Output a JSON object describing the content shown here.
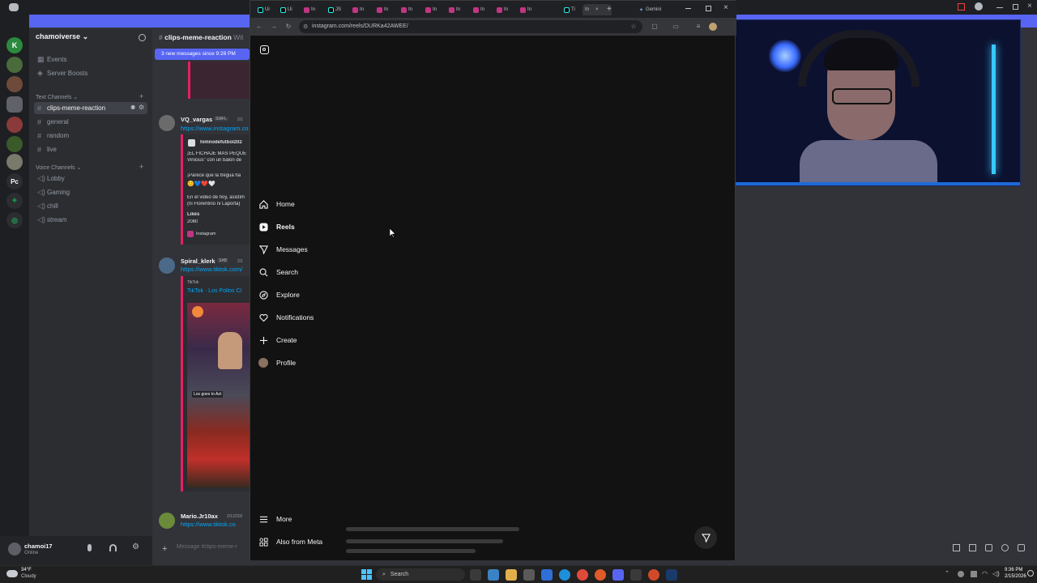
{
  "discord": {
    "server_name": "chamoiverse",
    "banner_text": "3 new messages since 9:28 PM",
    "channel_header": "clips-meme-reaction",
    "channel_header_extra": "Wit",
    "nav": [
      {
        "label": "Events",
        "icon": "calendar-icon"
      },
      {
        "label": "Server Boosts",
        "icon": "boost-icon"
      }
    ],
    "text_category": "Text Channels",
    "text_channels": [
      "clips-meme-reaction",
      "general",
      "random",
      "live"
    ],
    "voice_category": "Voice Channels",
    "voice_channels": [
      "Lobby",
      "Gaming",
      "chill",
      "stream"
    ],
    "server_rail_labels": [
      "Pc"
    ],
    "user": {
      "name": "chamoi17",
      "status": "Online"
    },
    "input_placeholder": "Message #clips-meme-r",
    "messages": [
      {
        "author": "VQ_vargas",
        "tag": "SWFL",
        "time": "2/1",
        "link": "https://www.instagram.co",
        "embed_author": "himnodefutbol202",
        "embed_lines": [
          "¡EL FICHAJE MÁS PEQUE",
          "Vinicius\" con un balón de",
          "¡Parece que la tregua ha",
          "En el video de hoy, asistim",
          "(ni Florentino ni Laporta)"
        ],
        "embed_likes_label": "Likes",
        "embed_likes": "2080",
        "embed_footer": "Instagram"
      },
      {
        "author": "Spiral_klerk",
        "tag": "SAB",
        "time": "2/1",
        "link": "https://www.tiktok.com/",
        "embed_provider": "TikTok",
        "embed_title": "TikTok · Los Pollos Cl",
        "video_caption": "Los goes to Azt"
      },
      {
        "author": "Mario.Jr10ax",
        "time": "2/12/202",
        "link": "https://www.tiktok.co"
      }
    ]
  },
  "browser": {
    "tabs": [
      {
        "label": "Ui",
        "kind": "tiktok"
      },
      {
        "label": "Ui",
        "kind": "tiktok"
      },
      {
        "label": "In",
        "kind": "instagram"
      },
      {
        "label": "JS",
        "kind": "tiktok"
      },
      {
        "label": "In",
        "kind": "instagram"
      },
      {
        "label": "In",
        "kind": "instagram"
      },
      {
        "label": "In",
        "kind": "instagram"
      },
      {
        "label": "In",
        "kind": "instagram"
      },
      {
        "label": "In",
        "kind": "instagram"
      },
      {
        "label": "In",
        "kind": "instagram"
      },
      {
        "label": "In",
        "kind": "instagram"
      },
      {
        "label": "In",
        "kind": "instagram"
      },
      {
        "label": "Ti",
        "kind": "tiktok"
      },
      {
        "label": "In",
        "kind": "instagram",
        "active": true
      }
    ],
    "other_tab": "Gemini",
    "url": "instagram.com/reels/DURKa42AWEE/"
  },
  "instagram": {
    "nav": [
      {
        "label": "Home",
        "icon": "home-icon"
      },
      {
        "label": "Reels",
        "icon": "reels-icon",
        "active": true
      },
      {
        "label": "Messages",
        "icon": "send-icon"
      },
      {
        "label": "Search",
        "icon": "search-icon"
      },
      {
        "label": "Explore",
        "icon": "compass-icon"
      },
      {
        "label": "Notifications",
        "icon": "heart-icon"
      },
      {
        "label": "Create",
        "icon": "plus-icon"
      },
      {
        "label": "Profile",
        "icon": "avatar-icon"
      }
    ],
    "bottom_nav": [
      {
        "label": "More",
        "icon": "menu-icon"
      },
      {
        "label": "Also from Meta",
        "icon": "meta-icon"
      }
    ]
  },
  "taskbar": {
    "weather_temp": "34°F",
    "weather_desc": "Cloudy",
    "search_label": "Search",
    "time": "9:36 PM",
    "date": "2/15/2026"
  },
  "colors": {
    "discord_blurple": "#5865f2",
    "discord_bg": "#313338",
    "instagram_bg": "#121212",
    "link": "#00a8fc"
  }
}
